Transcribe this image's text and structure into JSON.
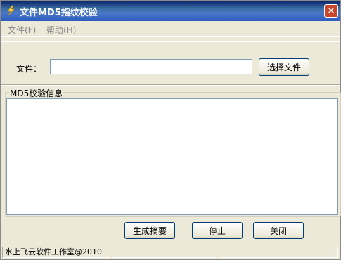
{
  "window": {
    "title": "文件MD5指纹校验",
    "close_glyph": "✕",
    "icon": "lightning-icon",
    "title_color": "#0a246a"
  },
  "menu": {
    "items": [
      {
        "label": "文件(F)"
      },
      {
        "label": "帮助(H)"
      }
    ]
  },
  "file_row": {
    "label": "文件：",
    "value": "",
    "browse_label": "选择文件"
  },
  "info_group": {
    "label": "MD5校验信息",
    "content": ""
  },
  "actions": {
    "generate_label": "生成摘要",
    "stop_label": "停止",
    "close_label": "关闭"
  },
  "status": {
    "panes": [
      "水上飞云软件工作室@2010",
      "",
      ""
    ]
  }
}
